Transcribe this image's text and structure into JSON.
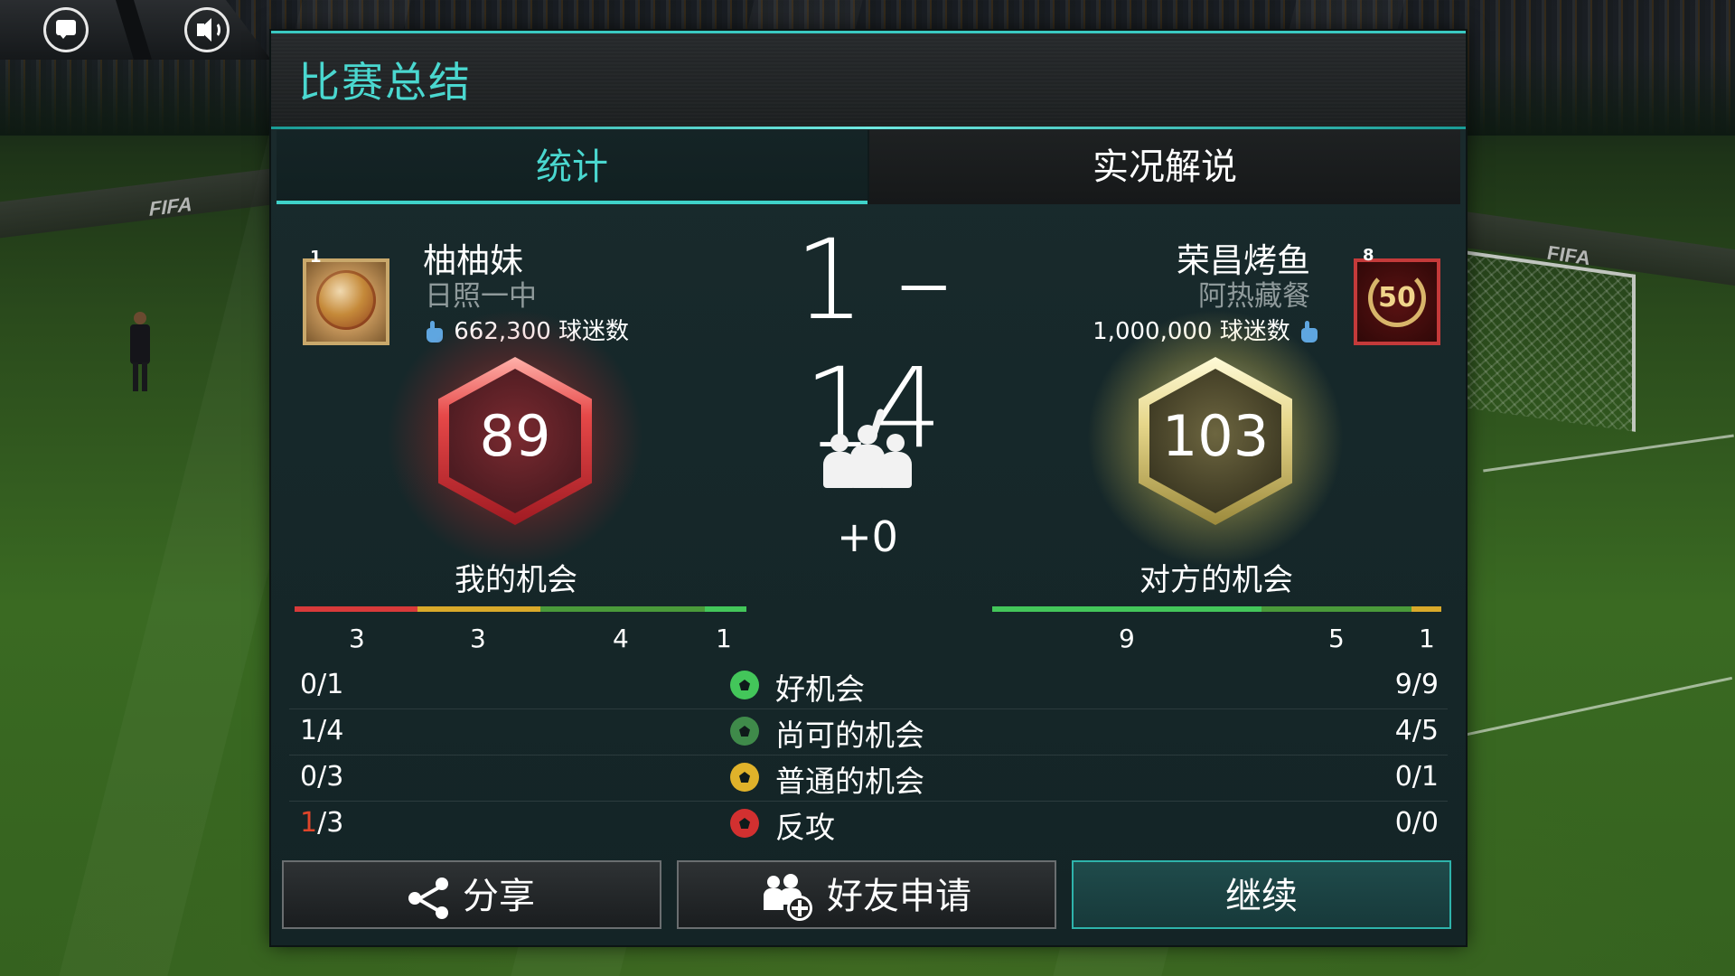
{
  "header": {
    "title": "比赛总结",
    "icons": [
      "chat-icon",
      "sound-icon"
    ]
  },
  "tabs": [
    {
      "label": "统计",
      "active": true
    },
    {
      "label": "实况解说",
      "active": false
    }
  ],
  "background": {
    "ad_left": "FIFA",
    "ad_right": "FIFA"
  },
  "home": {
    "badge_number": "1",
    "name": "柚柚妹",
    "club": "日照一中",
    "fans": "662,300 球迷数",
    "chance_value": "89",
    "chance_label": "我的机会",
    "bar_numbers": [
      "3",
      "3",
      "4",
      "1"
    ],
    "bar_colors": [
      "#d83a3a",
      "#d9a92a",
      "#4a9a3a",
      "#43c65a"
    ]
  },
  "away": {
    "badge_number": "8",
    "badge_level": "50",
    "name": "荣昌烤鱼",
    "club": "阿热藏餐",
    "fans": "1,000,000 球迷数",
    "chance_value": "103",
    "chance_label": "对方的机会",
    "bar_numbers": [
      "9",
      "5",
      "1"
    ],
    "bar_colors": [
      "#43c65a",
      "#4a9a3a",
      "#d9a92a"
    ]
  },
  "score": "1 – 14",
  "crowd_change": "+0",
  "rows": [
    {
      "left": "0/1",
      "label": "好机会",
      "right": "9/9",
      "ball_color": "#43c65a"
    },
    {
      "left_prefix": "",
      "left": "1/4",
      "label": "尚可的机会",
      "right": "4/5",
      "ball_color": "#3f8a4a"
    },
    {
      "left": "0/3",
      "label": "普通的机会",
      "right": "0/1",
      "ball_color": "#e0b22a"
    },
    {
      "left_prefix": "1",
      "left": "/3",
      "label": "反攻",
      "right": "0/0",
      "ball_color": "#d23030"
    }
  ],
  "buttons": {
    "share": "分享",
    "friend": "好友申请",
    "continue": "继续"
  },
  "colors": {
    "accent": "#4ad7cf",
    "panel": "#16282a",
    "counter_red": "#e0452a"
  }
}
